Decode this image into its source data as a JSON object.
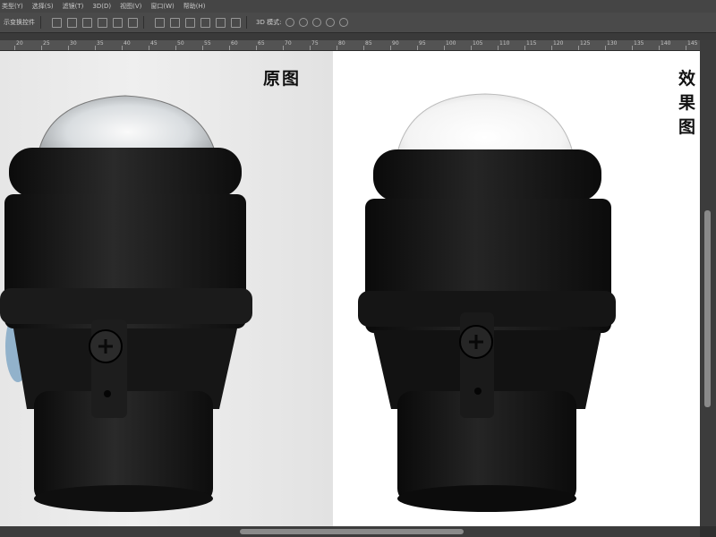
{
  "menu": {
    "items": [
      "类型(Y)",
      "选择(S)",
      "滤镜(T)",
      "3D(D)",
      "视图(V)",
      "窗口(W)",
      "帮助(H)"
    ]
  },
  "options": {
    "transform_label": "示变换控件",
    "mode_3d": "3D 模式:"
  },
  "ruler": {
    "numbers": [
      "20",
      "25",
      "30",
      "35",
      "40",
      "45",
      "50",
      "55",
      "60",
      "65",
      "70",
      "75",
      "80",
      "85",
      "90",
      "95",
      "100",
      "105",
      "110",
      "115",
      "120",
      "125",
      "130",
      "135",
      "140",
      "145"
    ]
  },
  "canvas": {
    "label_original": "原图",
    "label_result": "效果图"
  },
  "colors": {
    "lamp_body": "#141414",
    "background_left": "#e8e8e8",
    "background_right": "#ffffff"
  }
}
